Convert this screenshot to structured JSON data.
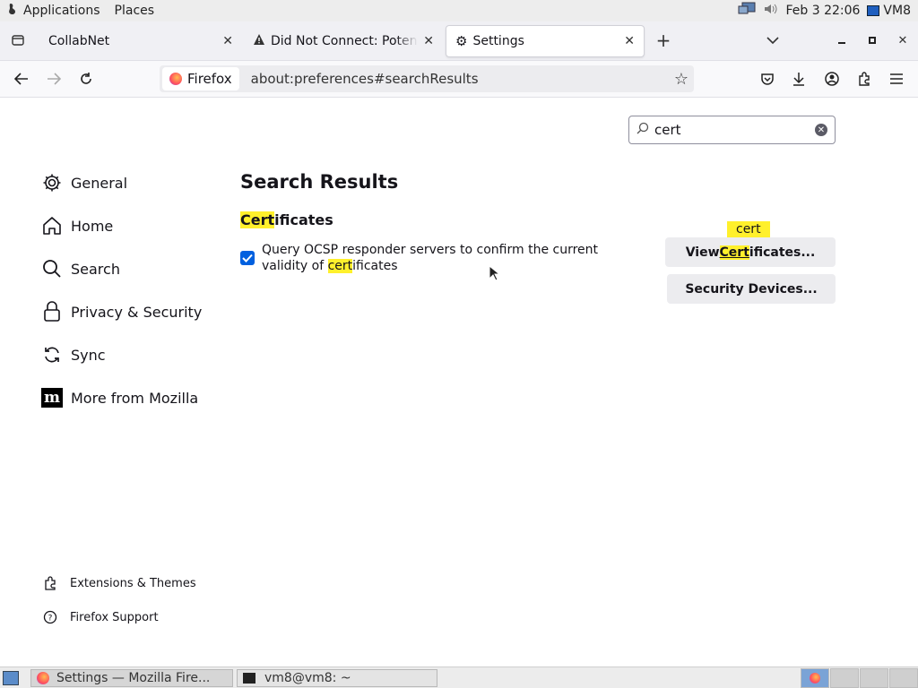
{
  "topbar": {
    "applications": "Applications",
    "places": "Places",
    "clock": "Feb 3 22:06",
    "host": "VM8"
  },
  "tabs": [
    {
      "title": "CollabNet"
    },
    {
      "title": "Did Not Connect: Poten"
    },
    {
      "title": "Settings"
    }
  ],
  "urlbar": {
    "identity": "Firefox",
    "url": "about:preferences#searchResults"
  },
  "search": {
    "value": "cert"
  },
  "sidebar": {
    "items": [
      {
        "label": "General"
      },
      {
        "label": "Home"
      },
      {
        "label": "Search"
      },
      {
        "label": "Privacy & Security"
      },
      {
        "label": "Sync"
      },
      {
        "label": "More from Mozilla"
      }
    ],
    "footer": [
      {
        "label": "Extensions & Themes"
      },
      {
        "label": "Firefox Support"
      }
    ]
  },
  "main": {
    "heading": "Search Results",
    "section": {
      "title_hl": "Cert",
      "title_rest": "ificates"
    },
    "ocsp": {
      "line1": "Query OCSP responder servers to confirm the current",
      "line2_pre": "validity of ",
      "line2_hl": "cert",
      "line2_post": "ificates",
      "checked": true
    },
    "view_button": {
      "pre": "View ",
      "hl": "Cert",
      "post": "ificates..."
    },
    "devices_button": "Security Devices...",
    "tooltip": "cert"
  },
  "taskbar": {
    "firefox": "Settings — Mozilla Fire...",
    "terminal": "vm8@vm8: ~"
  },
  "colors": {
    "accent": "#0060df",
    "highlight": "#fff02c"
  }
}
